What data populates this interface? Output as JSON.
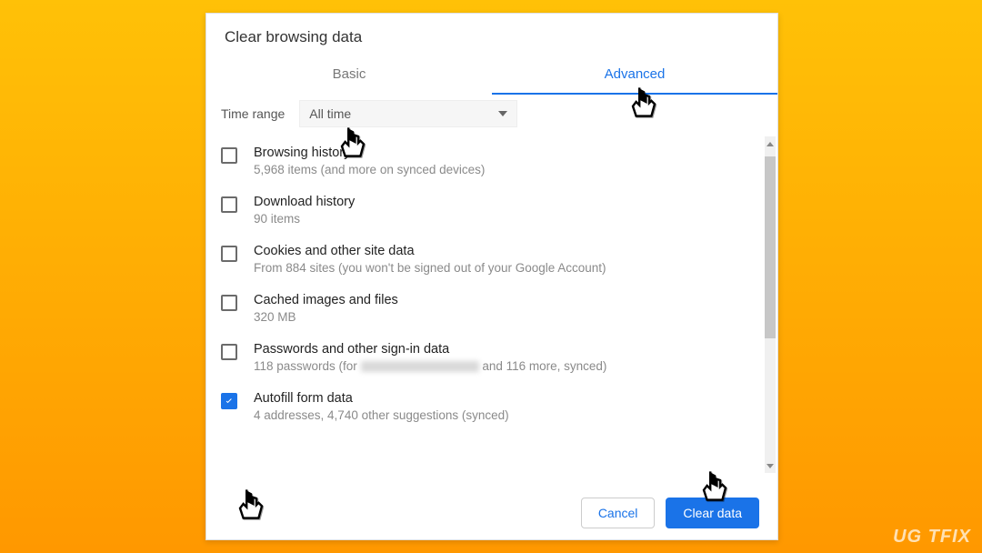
{
  "dialog": {
    "title": "Clear browsing data",
    "tabs": {
      "basic": "Basic",
      "advanced": "Advanced"
    },
    "time_range": {
      "label": "Time range",
      "value": "All time"
    },
    "items": [
      {
        "title": "Browsing history",
        "sub": "5,968 items (and more on synced devices)",
        "checked": false
      },
      {
        "title": "Download history",
        "sub": "90 items",
        "checked": false
      },
      {
        "title": "Cookies and other site data",
        "sub": "From 884 sites (you won't be signed out of your Google Account)",
        "checked": false
      },
      {
        "title": "Cached images and files",
        "sub": "320 MB",
        "checked": false
      },
      {
        "title": "Passwords and other sign-in data",
        "sub_pre": "118 passwords (for ",
        "sub_post": " and 116 more, synced)",
        "checked": false,
        "has_blur": true
      },
      {
        "title": "Autofill form data",
        "sub": "4 addresses, 4,740 other suggestions (synced)",
        "checked": true
      }
    ],
    "buttons": {
      "cancel": "Cancel",
      "clear": "Clear data"
    }
  },
  "watermark": "UG   TFIX"
}
